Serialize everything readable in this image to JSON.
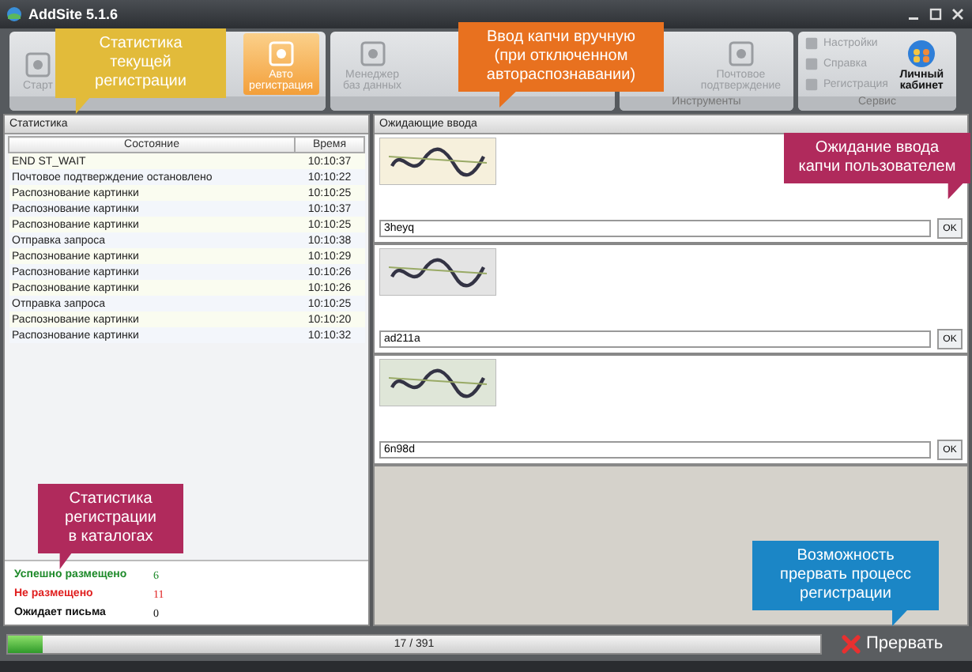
{
  "window": {
    "title": "AddSite 5.1.6"
  },
  "toolbar": {
    "groups": [
      {
        "items": [
          {
            "kind": "big",
            "label": "Старт",
            "selected": false
          },
          {
            "kind": "big",
            "label": "Авто\nрегистрация",
            "selected": true
          }
        ]
      },
      {
        "items": [
          {
            "kind": "big",
            "label": "Менеджер\nбаз данных",
            "selected": false
          }
        ]
      },
      {
        "label": "Инструменты",
        "items": [
          {
            "kind": "big",
            "label": "Почтовое\nподтверждение",
            "selected": false
          }
        ]
      },
      {
        "label": "Сервис",
        "items": [
          {
            "kind": "small",
            "label": "Настройки",
            "selected": false
          },
          {
            "kind": "small",
            "label": "Справка",
            "selected": false
          },
          {
            "kind": "small",
            "label": "Регистрация",
            "selected": false
          },
          {
            "kind": "profile",
            "label": "Личный\nкабинет",
            "selected": false
          }
        ]
      }
    ]
  },
  "stats_panel": {
    "title": "Статистика",
    "columns": [
      "Состояние",
      "Время"
    ],
    "rows": [
      [
        "END ST_WAIT",
        "10:10:37"
      ],
      [
        "Почтовое подтверждение остановлено",
        "10:10:22"
      ],
      [
        "Распознование картинки",
        "10:10:25"
      ],
      [
        "Распознование картинки",
        "10:10:37"
      ],
      [
        "Распознование картинки",
        "10:10:25"
      ],
      [
        "Отправка запроса",
        "10:10:38"
      ],
      [
        "Распознование картинки",
        "10:10:29"
      ],
      [
        "Распознование картинки",
        "10:10:26"
      ],
      [
        "Распознование картинки",
        "10:10:26"
      ],
      [
        "Отправка запроса",
        "10:10:25"
      ],
      [
        "Распознование картинки",
        "10:10:20"
      ],
      [
        "Распознование картинки",
        "10:10:32"
      ]
    ],
    "summary": [
      {
        "label": "Успешно размещено",
        "value": "6",
        "color": "#1e8a2a"
      },
      {
        "label": "Не размещено",
        "value": "11",
        "color": "#e02020"
      },
      {
        "label": "Ожидает письма",
        "value": "0",
        "color": "#111111"
      }
    ]
  },
  "captcha_panel": {
    "title": "Ожидающие ввода",
    "entries": [
      {
        "value": "3heyq",
        "button": "OK"
      },
      {
        "value": "ad211a",
        "button": "OK"
      },
      {
        "value": "6n98d",
        "button": "OK"
      }
    ]
  },
  "progress": {
    "text": "17 / 391",
    "level": 0.043
  },
  "stop_button": {
    "label": "Прервать"
  },
  "callouts": [
    {
      "text": "Статистика\nтекущей\nрегистрации",
      "color": "#e2bb3a"
    },
    {
      "text": "Ввод капчи вручную\n(при отключенном\nавтораспознавании)",
      "color": "#e8711f"
    },
    {
      "text": "Ожидание ввода\nкапчи пользователем",
      "color": "#b02a5c"
    },
    {
      "text": "Статистика\nрегистрации\nв каталогах",
      "color": "#b02a5c"
    },
    {
      "text": "Возможность\nпрервать процесс\nрегистрации",
      "color": "#1b86c6"
    }
  ]
}
